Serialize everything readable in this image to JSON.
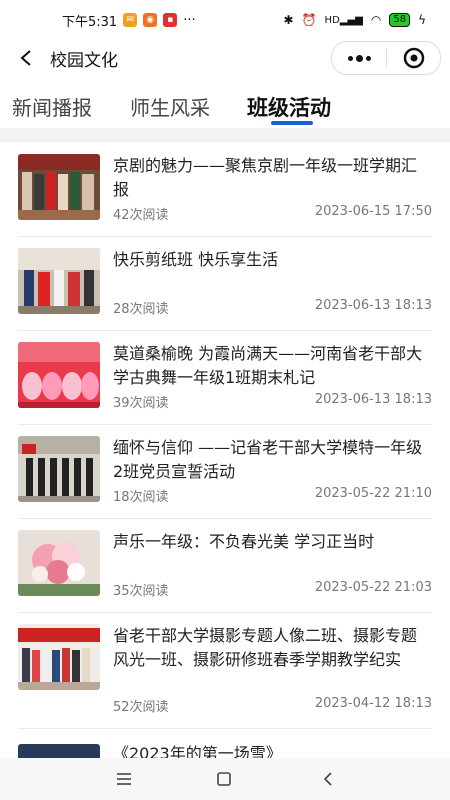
{
  "status_bar": {
    "time": "下午5:31",
    "more": "···",
    "network": "HD",
    "battery": "58"
  },
  "header": {
    "title": "校园文化"
  },
  "tabs": [
    {
      "label": "新闻播报",
      "active": false
    },
    {
      "label": "师生风采",
      "active": false
    },
    {
      "label": "班级活动",
      "active": true
    }
  ],
  "colors": {
    "accent": "#1a5fd6",
    "text": "#222222",
    "meta": "#777777"
  },
  "articles": [
    {
      "title": "京剧的魅力——聚焦京剧一年级一班学期汇报",
      "reads": "42次阅读",
      "date": "2023-06-15 17:50"
    },
    {
      "title": "快乐剪纸班 快乐享生活",
      "reads": "28次阅读",
      "date": "2023-06-13 18:13"
    },
    {
      "title": "莫道桑榆晚 为霞尚满天——河南省老干部大学古典舞一年级1班期末札记",
      "reads": "39次阅读",
      "date": "2023-06-13 18:13"
    },
    {
      "title": "缅怀与信仰 ——记省老干部大学模特一年级2班党员宣誓活动",
      "reads": "18次阅读",
      "date": "2023-05-22 21:10"
    },
    {
      "title": "声乐一年级：不负春光美 学习正当时",
      "reads": "35次阅读",
      "date": "2023-05-22 21:03"
    },
    {
      "title": "省老干部大学摄影专题人像二班、摄影专题风光一班、摄影研修班春季学期教学纪实",
      "reads": "52次阅读",
      "date": "2023-04-12 18:13"
    },
    {
      "title": "《2023年的第一场雪》",
      "reads": "",
      "date": ""
    }
  ]
}
